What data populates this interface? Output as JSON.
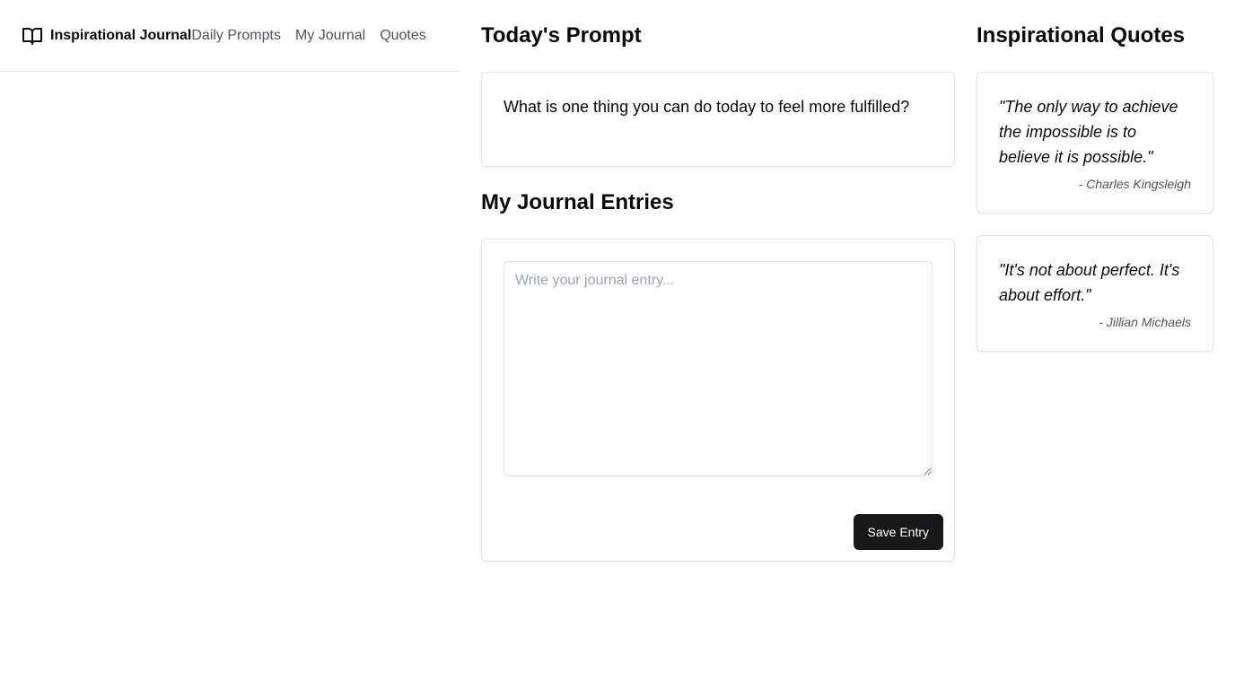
{
  "header": {
    "brand": "Inspirational Journal",
    "brand_icon": "book-open-icon",
    "nav": [
      {
        "label": "Daily Prompts"
      },
      {
        "label": "My Journal"
      },
      {
        "label": "Quotes"
      }
    ]
  },
  "prompt_section": {
    "title": "Today's Prompt",
    "text": "What is one thing you can do today to feel more fulfilled?"
  },
  "journal_section": {
    "title": "My Journal Entries",
    "entry_value": "",
    "entry_placeholder": "Write your journal entry...",
    "save_label": "Save Entry"
  },
  "quotes_section": {
    "title": "Inspirational Quotes",
    "quotes": [
      {
        "text": "\"The only way to achieve the impossible is to believe it is possible.\"",
        "author": "- Charles Kingsleigh"
      },
      {
        "text": "\"It's not about perfect. It's about effort.\"",
        "author": "- Jillian Michaels"
      }
    ]
  },
  "colors": {
    "primary_button": "#18181b",
    "border": "#e4e4e7",
    "muted_text": "#52525b",
    "placeholder": "#9ca3af"
  }
}
